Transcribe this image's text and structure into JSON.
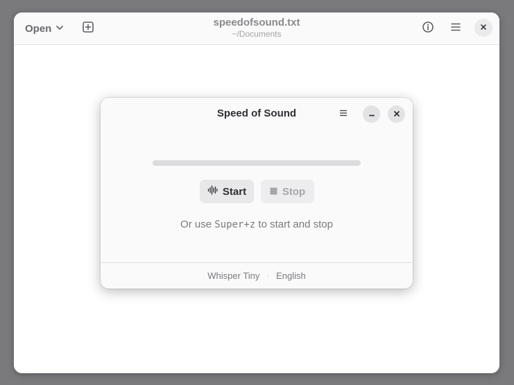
{
  "editor": {
    "open_label": "Open",
    "title": "speedofsound.txt",
    "subtitle": "~/Documents",
    "icons": {
      "open_dropdown": "chevron-down-icon",
      "new_tab": "new-tab-icon",
      "info": "info-icon",
      "menu": "hamburger-menu-icon",
      "close": "close-icon"
    }
  },
  "dialog": {
    "title": "Speed of Sound",
    "progress": 0,
    "start_label": "Start",
    "stop_label": "Stop",
    "hint_prefix": "Or use ",
    "hint_shortcut": "Super+z",
    "hint_suffix": " to start and stop",
    "footer": {
      "model": "Whisper Tiny",
      "separator": "·",
      "language": "English"
    },
    "icons": {
      "menu": "hamburger-menu-icon",
      "minimize": "minimize-icon",
      "close": "close-icon",
      "start": "waveform-icon",
      "stop": "stop-square-icon"
    }
  },
  "colors": {
    "accent": "#3584e4",
    "desktop_background": "#7a797c"
  }
}
